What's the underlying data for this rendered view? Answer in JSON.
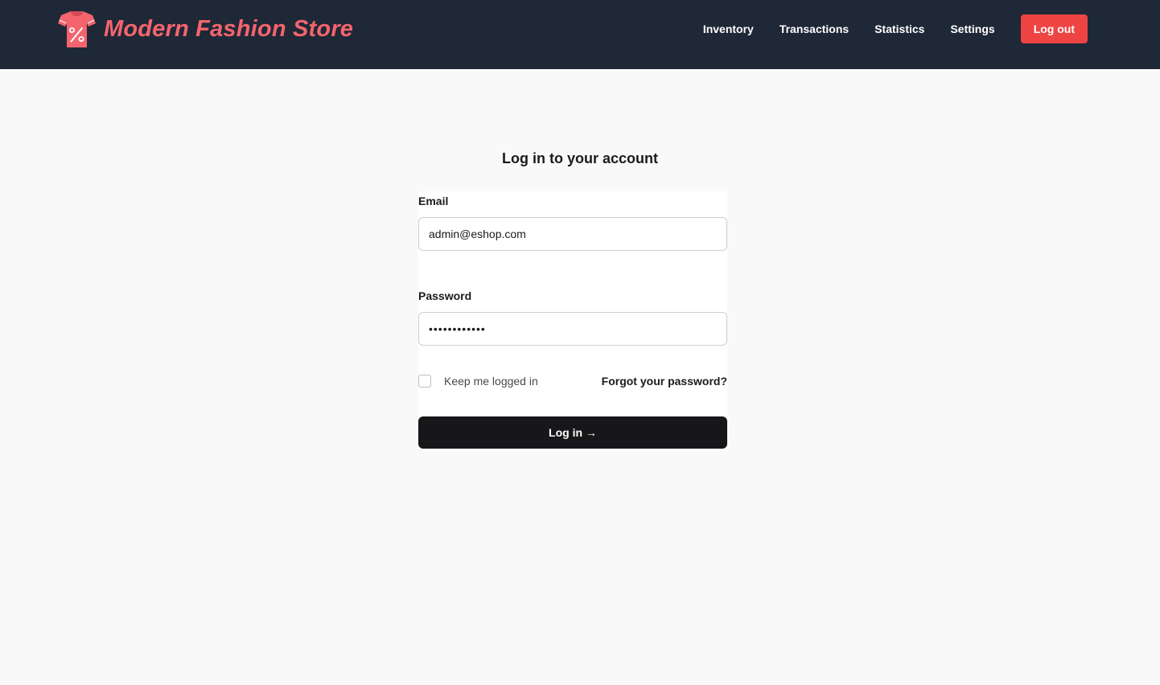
{
  "header": {
    "brand_title": "Modern Fashion Store",
    "brand_icon": "tshirt-percent-icon",
    "brand_color": "#f4646d",
    "background": "#1f2837",
    "nav": [
      {
        "label": "Inventory"
      },
      {
        "label": "Transactions"
      },
      {
        "label": "Statistics"
      },
      {
        "label": "Settings"
      }
    ],
    "logout_label": "Log out",
    "logout_color": "#ef4444"
  },
  "login": {
    "heading": "Log in to your account",
    "email_label": "Email",
    "email_value": "admin@eshop.com",
    "password_label": "Password",
    "password_value": "••••••••••••",
    "remember_label": "Keep me logged in",
    "remember_checked": false,
    "forgot_label": "Forgot your password?",
    "submit_label": "Log in →",
    "submit_color": "#17171a"
  }
}
